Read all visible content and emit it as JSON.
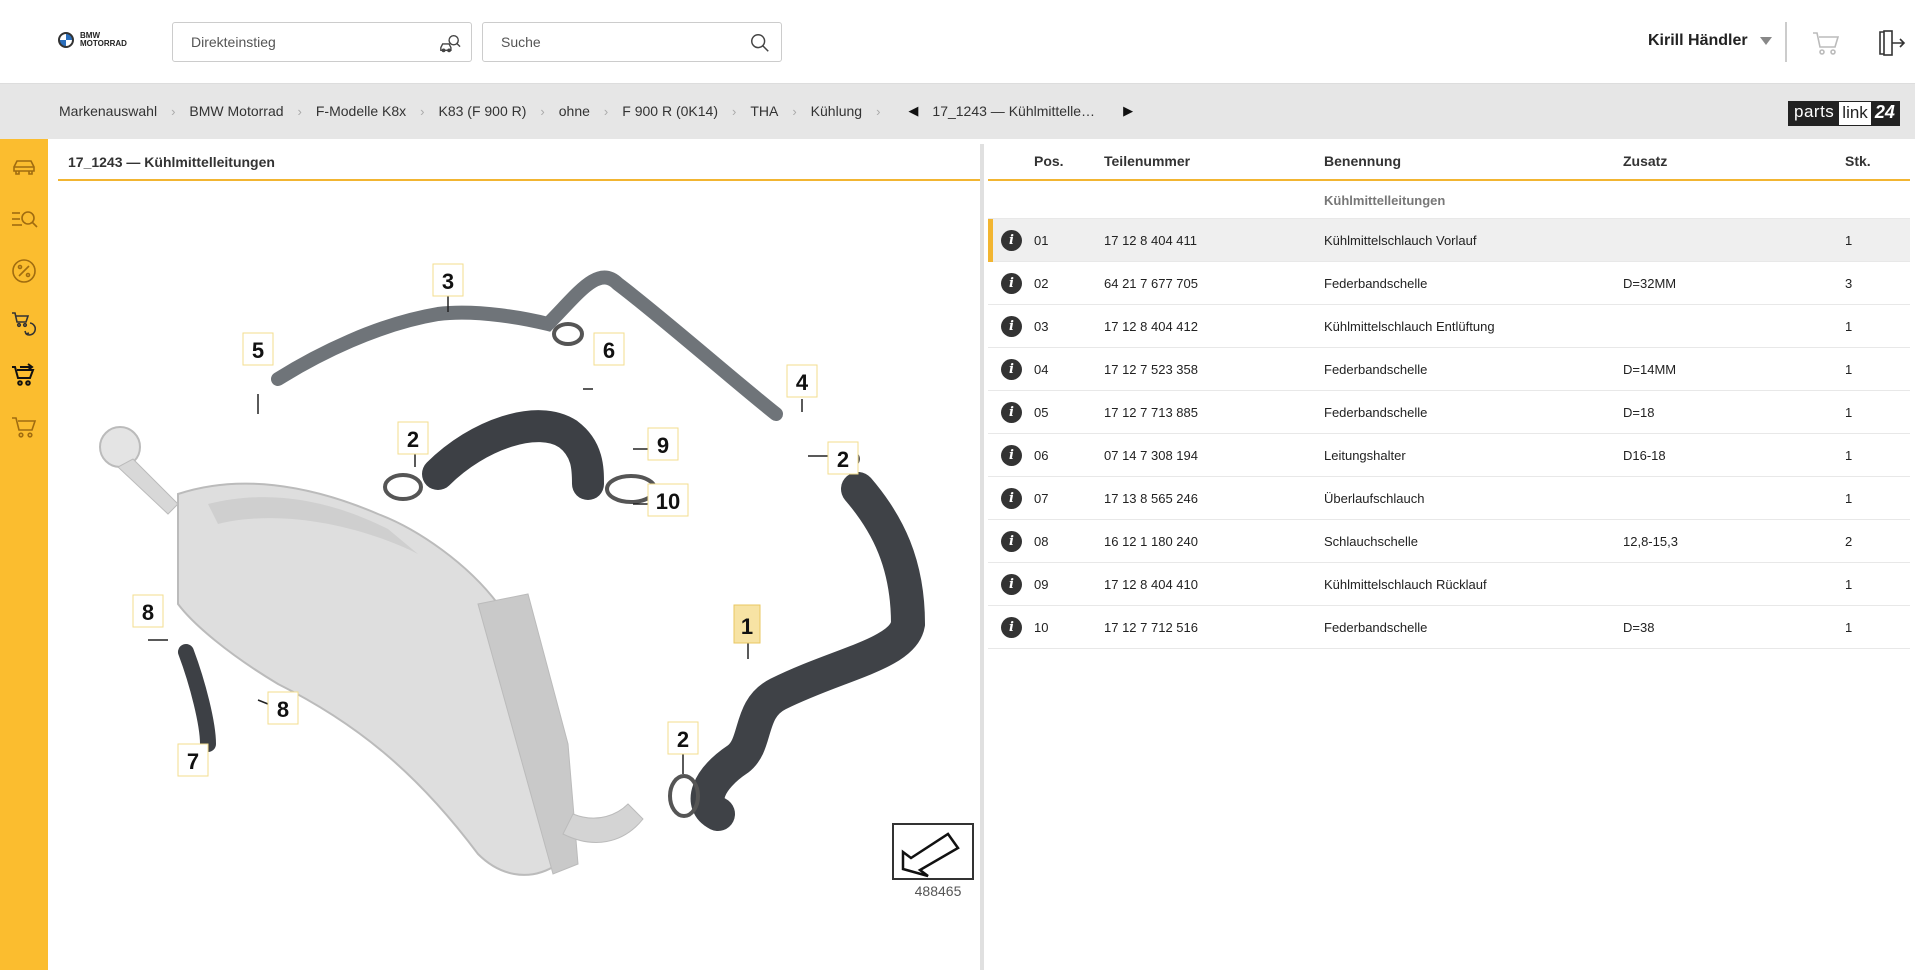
{
  "header": {
    "brand_text": "BMW MOTORRAD",
    "direct_entry_placeholder": "Direkteinstieg",
    "search_placeholder": "Suche",
    "user_name": "Kirill Händler"
  },
  "breadcrumb": {
    "items": [
      "Markenauswahl",
      "BMW Motorrad",
      "F-Modelle K8x",
      "K83 (F 900 R)",
      "ohne",
      "F 900 R (0K14)",
      "THA",
      "Kühlung"
    ],
    "current": "17_1243 — Kühlmittelle…",
    "partslink": {
      "a": "parts",
      "b": "link",
      "c": "24"
    }
  },
  "sidebar": {
    "items": [
      "car-icon",
      "search-list-icon",
      "percent-icon",
      "exchange-icon",
      "cart-transfer-icon",
      "cart-icon"
    ]
  },
  "diagram": {
    "title": "17_1243 — Kühlmittelleitungen",
    "image_number": "488465",
    "callouts": [
      "1",
      "2",
      "2",
      "2",
      "3",
      "4",
      "5",
      "6",
      "7",
      "8",
      "8",
      "9",
      "10"
    ]
  },
  "table": {
    "headers": {
      "pos": "Pos.",
      "number": "Teilenummer",
      "name": "Benennung",
      "addition": "Zusatz",
      "qty": "Stk."
    },
    "group": "Kühlmittelleitungen",
    "rows": [
      {
        "pos": "01",
        "number": "17 12 8 404 411",
        "name": "Kühlmittelschlauch Vorlauf",
        "addition": "",
        "qty": "1"
      },
      {
        "pos": "02",
        "number": "64 21 7 677 705",
        "name": "Federbandschelle",
        "addition": "D=32MM",
        "qty": "3"
      },
      {
        "pos": "03",
        "number": "17 12 8 404 412",
        "name": "Kühlmittelschlauch Entlüftung",
        "addition": "",
        "qty": "1"
      },
      {
        "pos": "04",
        "number": "17 12 7 523 358",
        "name": "Federbandschelle",
        "addition": "D=14MM",
        "qty": "1"
      },
      {
        "pos": "05",
        "number": "17 12 7 713 885",
        "name": "Federbandschelle",
        "addition": "D=18",
        "qty": "1"
      },
      {
        "pos": "06",
        "number": "07 14 7 308 194",
        "name": "Leitungshalter",
        "addition": "D16-18",
        "qty": "1"
      },
      {
        "pos": "07",
        "number": "17 13 8 565 246",
        "name": "Überlaufschlauch",
        "addition": "",
        "qty": "1"
      },
      {
        "pos": "08",
        "number": "16 12 1 180 240",
        "name": "Schlauchschelle",
        "addition": "12,8-15,3",
        "qty": "2"
      },
      {
        "pos": "09",
        "number": "17 12 8 404 410",
        "name": "Kühlmittelschlauch Rücklauf",
        "addition": "",
        "qty": "1"
      },
      {
        "pos": "10",
        "number": "17 12 7 712 516",
        "name": "Federbandschelle",
        "addition": "D=38",
        "qty": "1"
      }
    ],
    "info_glyph": "i"
  },
  "colors": {
    "accent": "#fbbd2f",
    "highlight": "#f2b531",
    "breadcrumb_bg": "#e6e6e6"
  }
}
